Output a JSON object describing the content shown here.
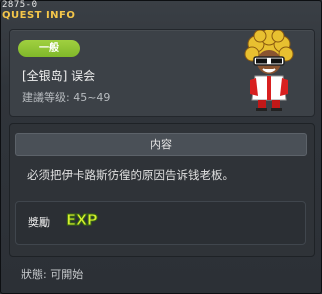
{
  "window": {
    "id_label": "2875-0",
    "title": "QUEST INFO"
  },
  "quest": {
    "category": "一般",
    "title": "[全银岛] 误会",
    "level": "建議等级: 45~49",
    "contents_header": "内容",
    "description": "必须把伊卡路斯彷徨的原因告诉钱老板。"
  },
  "reward": {
    "label": "獎勵",
    "type": "EXP"
  },
  "status": "狀態: 可開始",
  "colors": {
    "title": "#f4c64a",
    "badge": "#8cc435",
    "exp": "#d8f030"
  }
}
